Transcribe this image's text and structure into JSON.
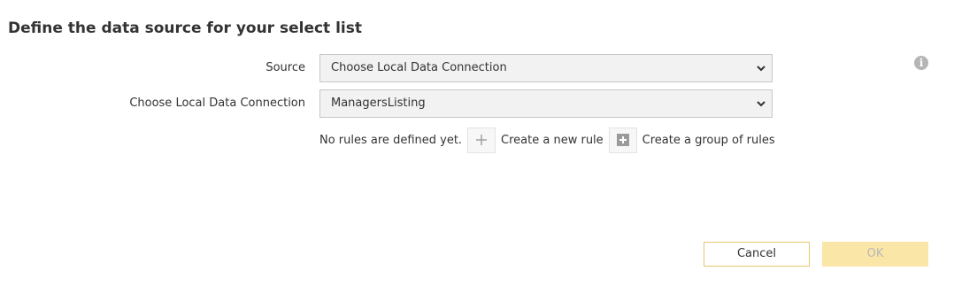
{
  "dialog": {
    "title": "Define the data source for your select list"
  },
  "form": {
    "source": {
      "label": "Source",
      "selected": "Choose Local Data Connection"
    },
    "connection": {
      "label": "Choose Local Data Connection",
      "selected": "ManagersListing"
    }
  },
  "rules": {
    "empty_text": "No rules are defined yet.",
    "create_rule_label": "Create a new rule",
    "create_group_label": "Create a group of rules"
  },
  "footer": {
    "cancel_label": "Cancel",
    "ok_label": "OK"
  },
  "icons": {
    "info": "info-icon",
    "plus": "plus-icon",
    "group": "plus-square-icon",
    "dropdown": "chevron-down-icon"
  },
  "colors": {
    "accent_border": "#e6c66d",
    "ok_disabled_bg": "#fae6a6",
    "select_bg": "#f2f2f2"
  }
}
